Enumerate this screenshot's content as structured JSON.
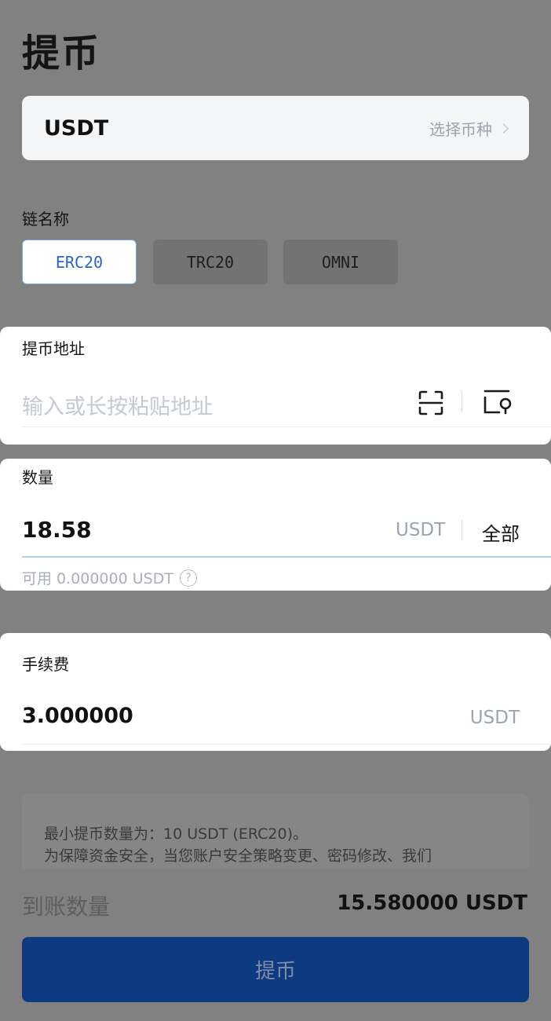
{
  "page": {
    "title": "提币"
  },
  "coin": {
    "name": "USDT",
    "select_label": "选择币种"
  },
  "chain": {
    "label": "链名称",
    "options": [
      {
        "label": "ERC20",
        "selected": true
      },
      {
        "label": "TRC20",
        "selected": false
      },
      {
        "label": "OMNI",
        "selected": false
      }
    ]
  },
  "address": {
    "label": "提币地址",
    "placeholder": "输入或长按粘贴地址"
  },
  "amount": {
    "label": "数量",
    "value": "18.58",
    "unit": "USDT",
    "all_label": "全部",
    "available": "可用 0.000000 USDT",
    "help_icon": "?"
  },
  "fee": {
    "label": "手续费",
    "value": "3.000000",
    "unit": "USDT"
  },
  "notice": {
    "line1": "最小提币数量为：10 USDT (ERC20)。",
    "line2": "为保障资金安全，当您账户安全策略变更、密码修改、我们"
  },
  "receive": {
    "label": "到账数量",
    "value": "15.580000 USDT"
  },
  "submit": {
    "label": "提币"
  },
  "colors": {
    "overlay": "#818181",
    "accent": "#2a63c9",
    "button": "#0d3a80",
    "muted_text": "#9aa4b2"
  },
  "icons": [
    "chevron-right-icon",
    "scan-icon",
    "address-book-icon",
    "help-icon"
  ]
}
